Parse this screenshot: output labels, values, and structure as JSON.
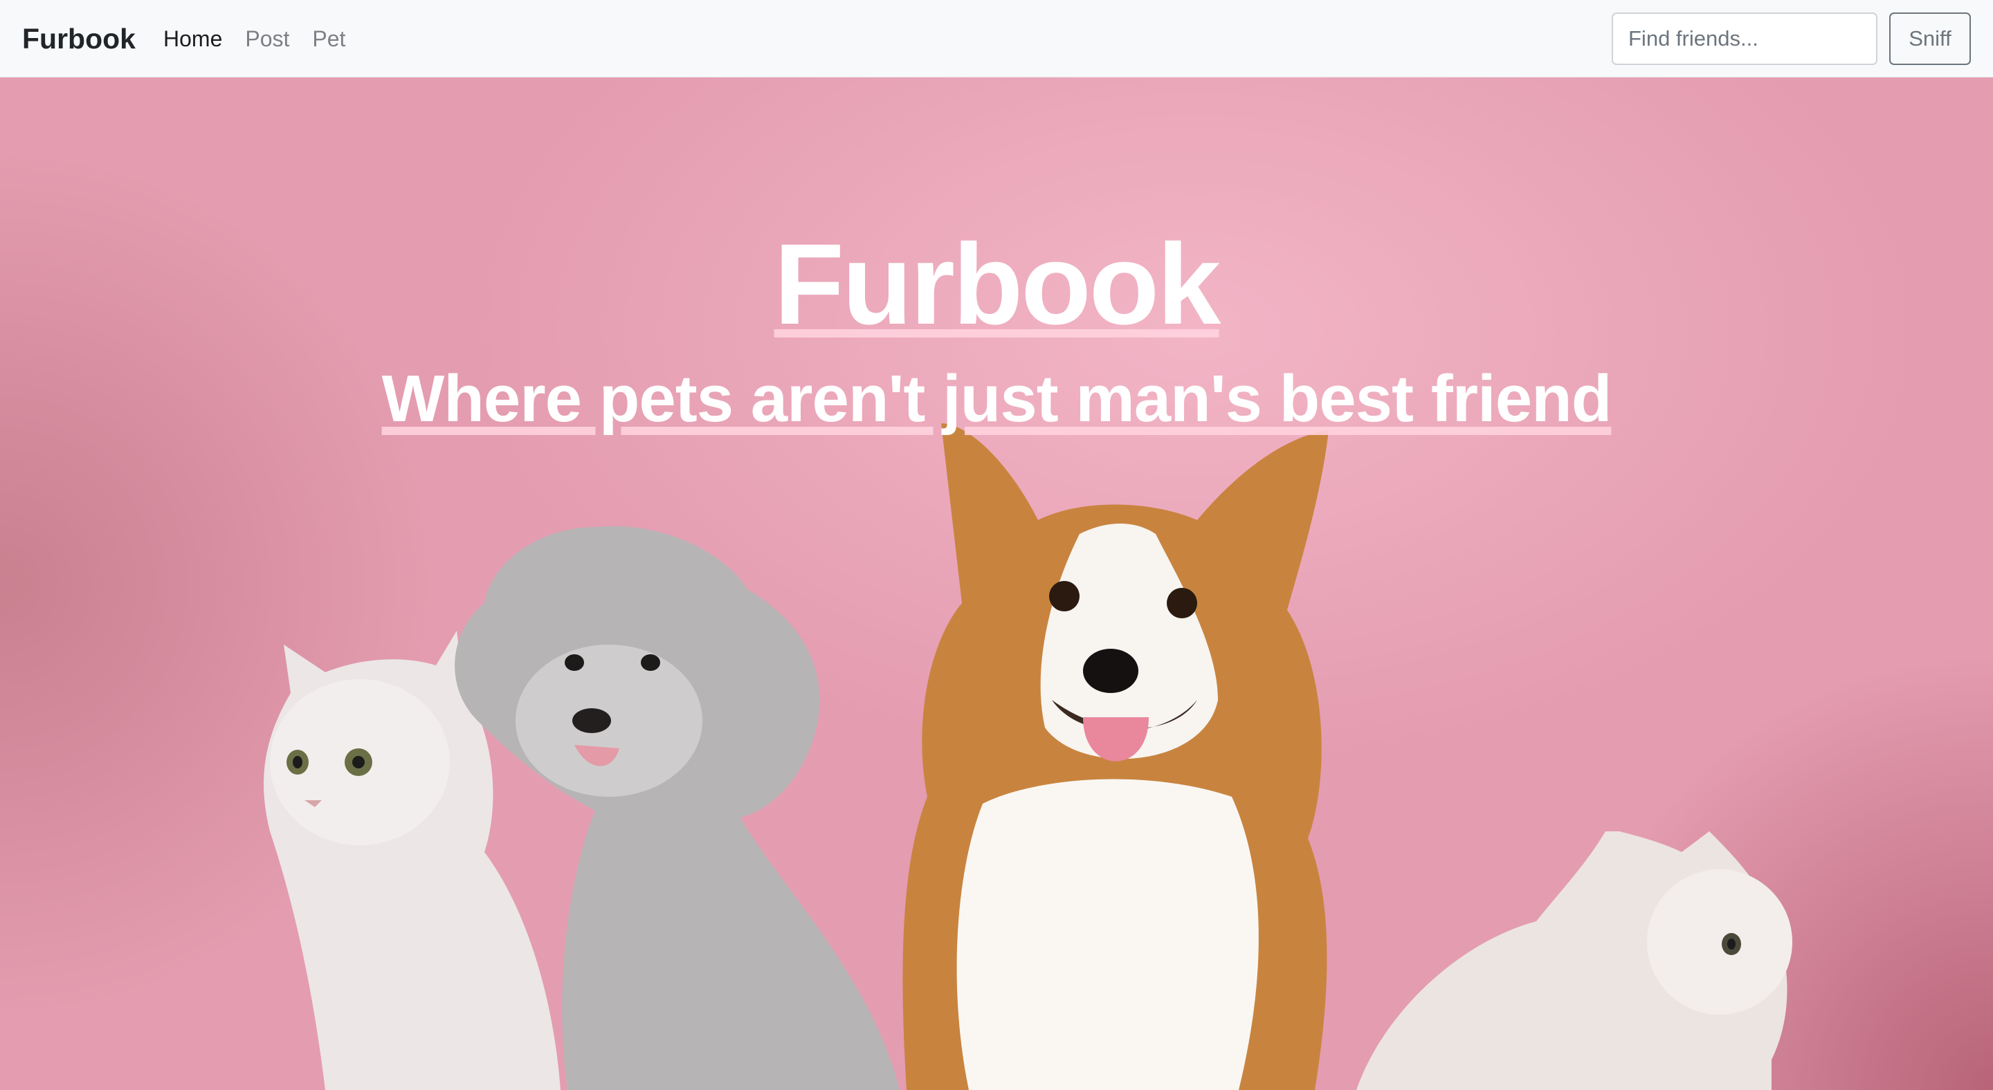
{
  "navbar": {
    "brand": "Furbook",
    "links": [
      {
        "label": "Home",
        "active": true
      },
      {
        "label": "Post",
        "active": false
      },
      {
        "label": "Pet",
        "active": false
      }
    ],
    "search": {
      "placeholder": "Find friends...",
      "value": ""
    },
    "search_button": "Sniff"
  },
  "hero": {
    "title": "Furbook",
    "subtitle": "Where pets aren't just man's best friend",
    "image_content": [
      "cat",
      "poodle",
      "corgi",
      "cat"
    ]
  },
  "colors": {
    "navbar_bg": "#f8f9fa",
    "hero_bg": "#e8a3b5",
    "text_on_hero": "#ffffff"
  }
}
